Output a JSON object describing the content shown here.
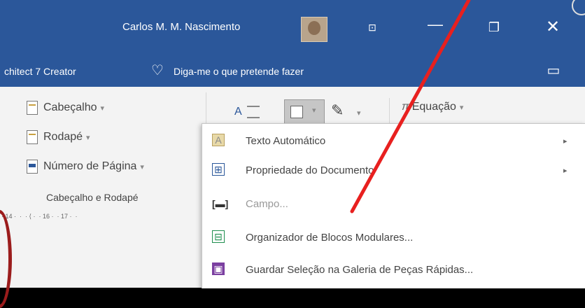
{
  "titlebar": {
    "user_name": "Carlos M. M. Nascimento",
    "ribbon_display_icon": "ribbon-display-icon",
    "minimize_icon": "minimize-icon",
    "restore_icon": "restore-icon",
    "close_icon": "close-icon",
    "minimize_glyph": "—",
    "restore_glyph": "❐",
    "close_glyph": "✕",
    "ribbon_glyph": "⊡"
  },
  "tellme": {
    "tab_partial": "chitect 7 Creator",
    "placeholder": "Diga-me o que pretende fazer",
    "bulb_glyph": "♡",
    "comment_glyph": "▭"
  },
  "ribbon": {
    "header_footer_group": {
      "items": [
        {
          "label": "Cabeçalho",
          "caret": "▾"
        },
        {
          "label": "Rodapé",
          "caret": "▾"
        },
        {
          "label": "Número de Página",
          "caret": "▾"
        }
      ],
      "group_label": "Cabeçalho e Rodapé"
    },
    "text_group": {
      "textbox_letter": "A",
      "quickparts_caret": "▾",
      "signature_caret": "▾",
      "equation_label": "Equação",
      "equation_icon": "π",
      "equation_caret": "▾"
    },
    "ruler_text": "· 14 ·  ·  · ⟨ ·  · 16 ·  · 17 ·  ·"
  },
  "menu": {
    "items": [
      {
        "label": "Texto Automático",
        "icon": "autotext-icon",
        "glyph": "A",
        "has_submenu": true,
        "arrow": "▸",
        "disabled": false
      },
      {
        "label": "Propriedade do Documento",
        "icon": "document-property-icon",
        "glyph": "⊞",
        "has_submenu": true,
        "arrow": "▸",
        "disabled": false
      },
      {
        "label": "Campo...",
        "icon": "field-icon",
        "glyph": "[▬]",
        "has_submenu": false,
        "disabled": true
      },
      {
        "label": "Organizador de Blocos Modulares...",
        "icon": "building-blocks-organizer-icon",
        "glyph": "⊟",
        "has_submenu": false,
        "disabled": false
      },
      {
        "label": "Guardar Seleção na Galeria de Peças Rápidas...",
        "icon": "save-selection-icon",
        "glyph": "▣",
        "has_submenu": false,
        "disabled": false
      }
    ]
  },
  "colors": {
    "title_bar": "#2b579a",
    "ribbon_bg": "#f3f3f3",
    "menu_bg": "#ffffff",
    "annotation_arrow": "#e8201f"
  }
}
